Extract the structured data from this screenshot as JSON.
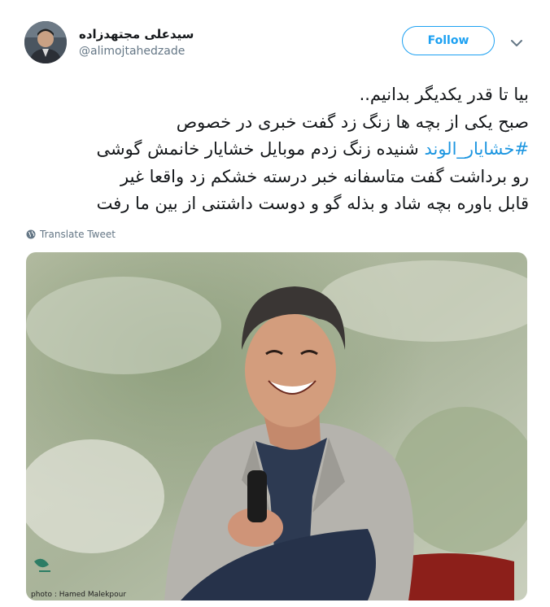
{
  "tweet": {
    "display_name": "سیدعلی مجتهدزاده",
    "handle": "@alimojtahedzade",
    "follow_label": "Follow",
    "text_lines": [
      "بیا تا قدر یکدیگر بدانیم..",
      "صبح یکی از بچه ها زنگ زد گفت خبری در خصوص",
      "شنیده زنگ زدم موبایل خشایار خانمش گوشی"
    ],
    "hashtag": "#خشایار_الوند",
    "text_lines_after": [
      "رو برداشت گفت متاسفانه خبر درسته خشکم زد واقعا غیر",
      "قابل باوره بچه شاد و بذله گو و دوست داشتنی از بین ما رفت"
    ],
    "translate_label": "Translate Tweet",
    "photo_credit": "photo : Hamed Malekpour"
  },
  "colors": {
    "accent": "#1da1f2",
    "hashtag": "#1b95e0",
    "muted": "#657786"
  },
  "icons": {
    "caret": "chevron-down-icon",
    "translate": "globe-icon"
  }
}
